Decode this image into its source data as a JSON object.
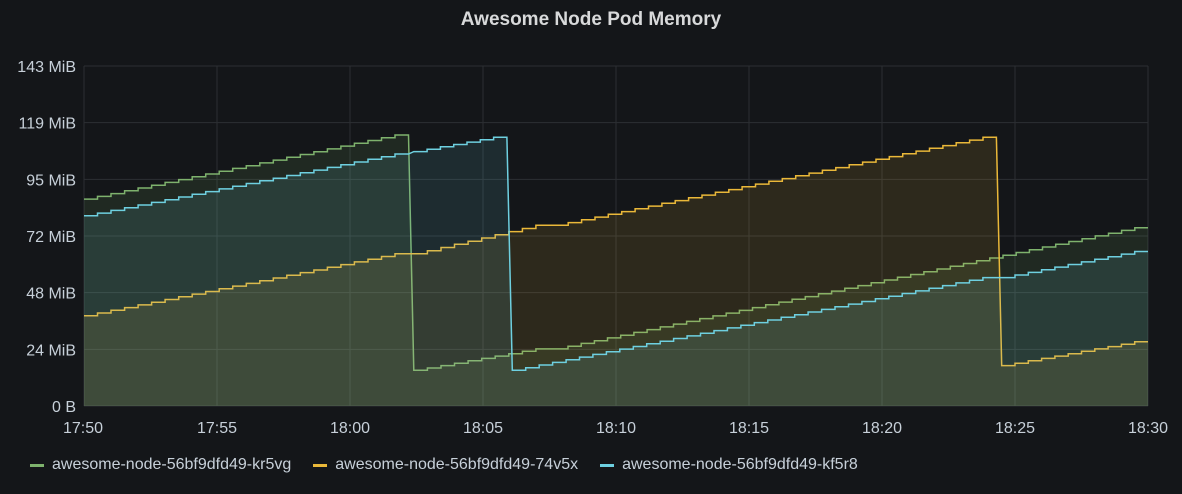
{
  "panel": {
    "title": "Awesome Node Pod Memory"
  },
  "chart_data": {
    "type": "area",
    "title": "Awesome Node Pod Memory",
    "y_ticks": [
      "0 B",
      "24 MiB",
      "48 MiB",
      "72 MiB",
      "95 MiB",
      "119 MiB",
      "143 MiB"
    ],
    "x_ticks": [
      "17:50",
      "17:55",
      "18:00",
      "18:05",
      "18:10",
      "18:15",
      "18:20",
      "18:25",
      "18:30"
    ],
    "x_range": [
      0,
      40
    ],
    "ylim": [
      0,
      143
    ],
    "grid": true,
    "legend_position": "bottom-left",
    "series": [
      {
        "name": "awesome-node-56bf9dfd49-kr5vg",
        "color": "#7eb26d",
        "x": [
          0,
          12.2,
          12.4,
          17.5,
          17.7,
          40
        ],
        "y": [
          87,
          114,
          15,
          24,
          24,
          75
        ]
      },
      {
        "name": "awesome-node-56bf9dfd49-74v5x",
        "color": "#eab839",
        "x": [
          0,
          12.2,
          12.4,
          17.5,
          17.7,
          34.3,
          34.5,
          40
        ],
        "y": [
          38,
          64,
          64,
          76,
          76,
          113,
          17,
          27
        ]
      },
      {
        "name": "awesome-node-56bf9dfd49-kf5r8",
        "color": "#6ed0e0",
        "x": [
          0,
          12.2,
          12.4,
          15.9,
          16.1,
          34.3,
          34.5,
          40
        ],
        "y": [
          80,
          106,
          107,
          113,
          15,
          54,
          54,
          65
        ]
      }
    ]
  }
}
